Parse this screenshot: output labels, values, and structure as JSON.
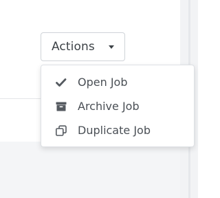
{
  "actions_button": {
    "label": "Actions",
    "caret_icon": "caret-down-icon"
  },
  "dropdown": {
    "items": [
      {
        "label": "Open Job",
        "icon": "check-icon"
      },
      {
        "label": "Archive Job",
        "icon": "archive-icon"
      },
      {
        "label": "Duplicate Job",
        "icon": "duplicate-icon"
      }
    ]
  },
  "colors": {
    "text": "#4a4f55",
    "icon": "#555a60",
    "border": "#cfd3d8",
    "panel_bg": "#f4f5f7"
  }
}
